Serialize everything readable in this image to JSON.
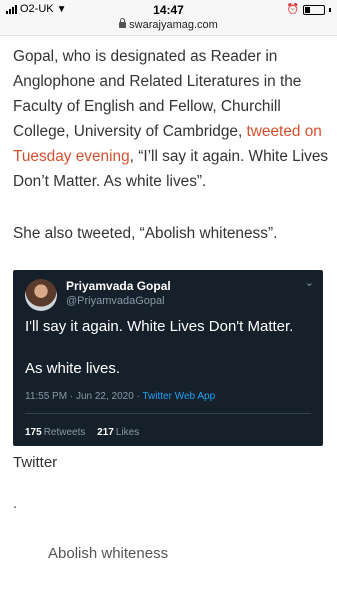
{
  "status_bar": {
    "carrier": "O2-UK",
    "time": "14:47",
    "battery_level": 0.25
  },
  "browser": {
    "url": "swarajyamag.com"
  },
  "article": {
    "para1_before_link": "Gopal, who is designated as Reader in Anglophone and Related Literatures in the Faculty of English and Fellow, Churchill College, University of Cambridge, ",
    "para1_link": "tweeted on Tuesday evening",
    "para1_after_link": ", “I’ll say it again. White Lives Don’t Matter. As white lives”.",
    "para2": "She also tweeted, “Abolish whiteness”.",
    "link_color": "#d34f2d"
  },
  "tweet": {
    "name": "Priyamvada Gopal",
    "handle": "@PriyamvadaGopal",
    "text_line1": "I'll say it again. White Lives Don't Matter.",
    "text_line2": "As white lives.",
    "timestamp": "11:55 PM · Jun 22, 2020",
    "separator": " · ",
    "app": "Twitter Web App",
    "retweets_count": "175",
    "retweets_label": "Retweets",
    "likes_count": "217",
    "likes_label": "Likes",
    "background": "#15202b"
  },
  "caption": "Twitter",
  "dot": ".",
  "sub_heading": "Abolish whiteness"
}
